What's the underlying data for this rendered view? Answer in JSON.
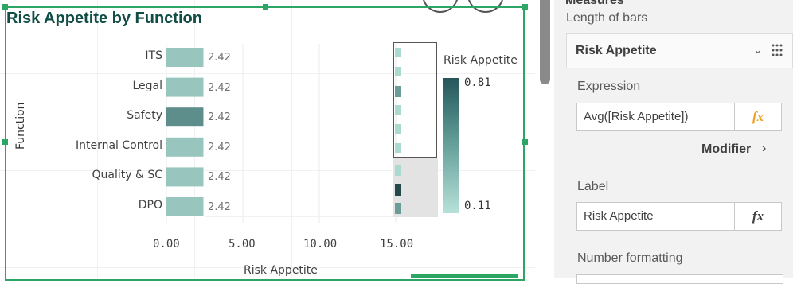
{
  "chart": {
    "title": "Risk Appetite by Function",
    "y_axis_title": "Function",
    "x_axis_title": "Risk Appetite",
    "x_ticks": [
      "0.00",
      "5.00",
      "10.00",
      "15.00"
    ],
    "legend": {
      "title": "Risk Appetite",
      "max_label": "0.81",
      "min_label": "0.11"
    },
    "colors": {
      "accent_frame": "#2da564",
      "title": "#0f4d45",
      "bar_light": "#a9d9cf",
      "bar_dark": "#6a9c98"
    }
  },
  "chart_data": {
    "type": "bar",
    "orientation": "horizontal",
    "title": "Risk Appetite by Function",
    "xlabel": "Risk Appetite",
    "ylabel": "Function",
    "categories": [
      "ITS",
      "Legal",
      "Safety",
      "Internal Control",
      "Quality & SC",
      "DPO"
    ],
    "values": [
      2.42,
      2.42,
      2.42,
      2.42,
      2.42,
      2.42
    ],
    "value_labels": [
      "2.42",
      "2.42",
      "2.42",
      "2.42",
      "2.42",
      "2.42"
    ],
    "color_values": [
      0.2,
      0.2,
      0.6,
      0.2,
      0.2,
      0.2
    ],
    "xlim": [
      0,
      17.5
    ],
    "grid": true,
    "legend_position": "right",
    "color_legend_range": [
      0.11,
      0.81
    ]
  },
  "panel": {
    "header": "Measures",
    "subheader": "Length of bars",
    "measure_title": "Risk Appetite",
    "expression_label": "Expression",
    "expression_value": "Avg([Risk Appetite])",
    "fx_symbol": "fx",
    "modifier_label": "Modifier",
    "modifier_chevron": "›",
    "collapse_chevron": "⌄",
    "label_label": "Label",
    "label_value": "Risk Appetite",
    "number_formatting_label": "Number formatting",
    "icons": {
      "fx_expression": "fx-icon",
      "drag": "drag-grip-icon"
    }
  }
}
